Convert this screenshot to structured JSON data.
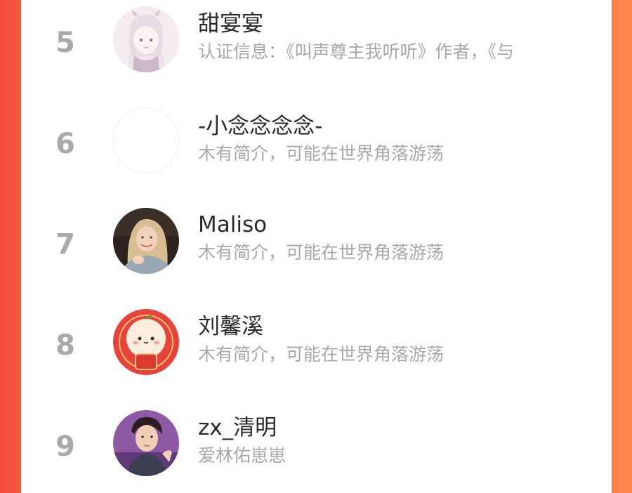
{
  "list": {
    "items": [
      {
        "rank": "5",
        "name": "甜宴宴",
        "desc": "认证信息：《叫声尊主我听听》作者，《与",
        "avatar": "anime-girl-avatar"
      },
      {
        "rank": "6",
        "name": "-小念念念念-",
        "desc": "木有简介，可能在世界角落游荡",
        "avatar": "blank-avatar"
      },
      {
        "rank": "7",
        "name": "Maliso",
        "desc": "木有简介，可能在世界角落游荡",
        "avatar": "photo-girl-avatar"
      },
      {
        "rank": "8",
        "name": "刘馨溪",
        "desc": "木有简介，可能在世界角落游荡",
        "avatar": "cartoon-face-avatar"
      },
      {
        "rank": "9",
        "name": "zx_清明",
        "desc": "爱林佑崽崽",
        "avatar": "anime-boy-avatar"
      }
    ]
  },
  "colors": {
    "accent_left": "#f34b3e",
    "accent_right": "#ff8a4c",
    "rank_gray": "#a9a9a9",
    "desc_gray": "#a8a8a8"
  }
}
